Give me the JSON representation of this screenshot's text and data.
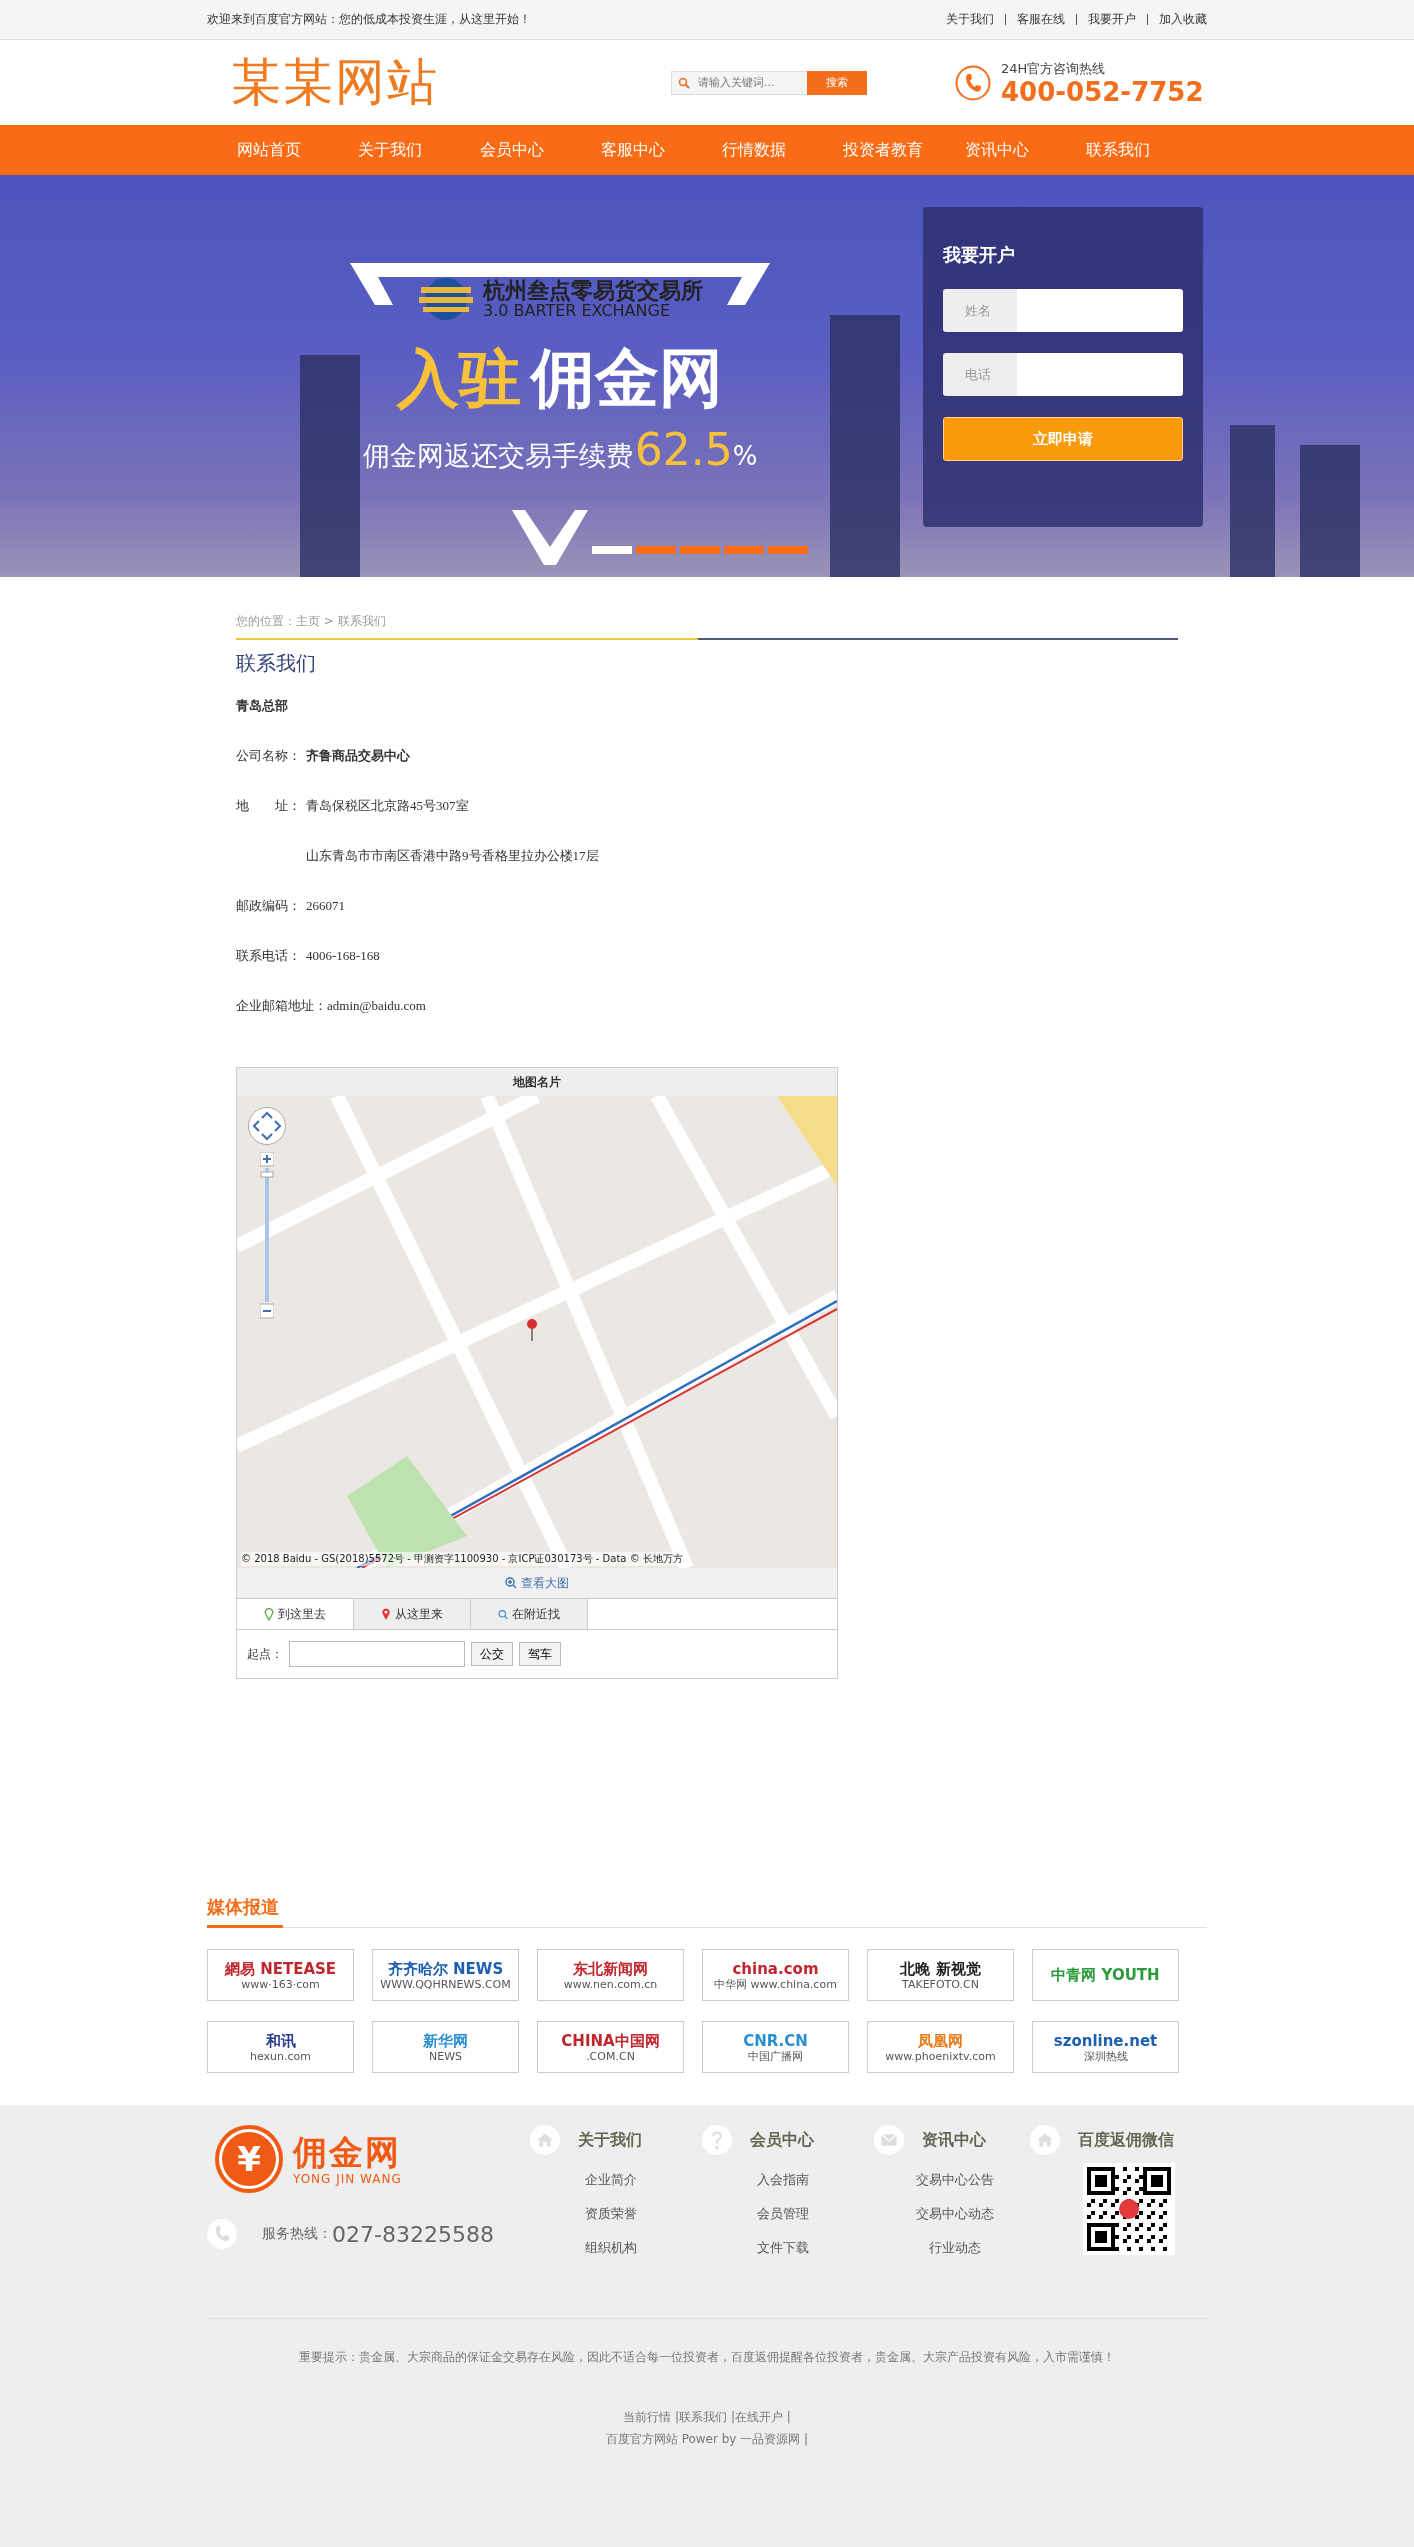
{
  "top_bar": {
    "welcome": "欢迎来到百度官方网站：您的低成本投资生涯，从这里开始！",
    "links": [
      "关于我们",
      "客服在线",
      "我要开户",
      "加入收藏"
    ]
  },
  "header": {
    "logo": "某某网站",
    "search": {
      "placeholder": "请输入关键词...",
      "button": "搜索"
    },
    "hotline": {
      "label": "24H官方咨询热线",
      "number": "400-052-7752"
    }
  },
  "nav": [
    "网站首页",
    "关于我们",
    "会员中心",
    "客服中心",
    "行情数据",
    "投资者教育",
    "资讯中心",
    "联系我们"
  ],
  "banner": {
    "exchange_name": "杭州叁点零易货交易所",
    "exchange_en": "3.0 BARTER EXCHANGE",
    "headline_script": "入驻",
    "headline": "佣金网",
    "tagline": "佣金网返还交易手续费",
    "rate": "62.5",
    "percent": "%",
    "slides": [
      {
        "selected": true
      },
      {
        "selected": false
      },
      {
        "selected": false
      },
      {
        "selected": false
      },
      {
        "selected": false
      }
    ],
    "signup": {
      "title": "我要开户",
      "fields": [
        {
          "placeholder": "姓名"
        },
        {
          "placeholder": "电话"
        }
      ],
      "button": "立即申请"
    }
  },
  "breadcrumb": "您的位置：主页 > 联系我们",
  "page_title": "联系我们",
  "contact": {
    "heading": "青岛总部",
    "rows": [
      {
        "kind": "bold",
        "label": "公司名称：",
        "value": "齐鲁商品交易中心"
      },
      {
        "kind": "plain",
        "label": "地　　址：",
        "value": "青岛保税区北京路45号307室"
      },
      {
        "kind": "continued",
        "value": "山东青岛市市南区香港中路9号香格里拉办公楼17层"
      },
      {
        "kind": "plain",
        "label": "邮政编码：",
        "value": "266071"
      },
      {
        "kind": "plain",
        "label": "联系电话：",
        "value": "4006-168-168"
      },
      {
        "kind": "plain",
        "label": "企业邮箱地址：",
        "value": "admin@baidu.com"
      }
    ]
  },
  "map_card": {
    "title": "地图名片",
    "copyright": "© 2018 Baidu - GS(2018)5572号 - 甲测资字1100930 - 京ICP证030173号 - Data © 长地万方",
    "view_large": "查看大图",
    "tabs": [
      {
        "label": "到这里去",
        "selected": true
      },
      {
        "label": "从这里来",
        "selected": false
      },
      {
        "label": "在附近找",
        "selected": false
      }
    ],
    "start_label": "起点：",
    "buttons": [
      "公交",
      "驾车"
    ]
  },
  "media": {
    "title": "媒体报道",
    "logos": [
      {
        "main": "網易 NETEASE",
        "sub": "www·163·com",
        "color": "#c0262d"
      },
      {
        "main": "齐齐哈尔 NEWS",
        "sub": "WWW.QQHRNEWS.COM",
        "color": "#1f5fb0"
      },
      {
        "main": "东北新闻网",
        "sub": "www.nen.com.cn",
        "color": "#c0262d"
      },
      {
        "main": "china.com",
        "sub": "中华网 www.china.com",
        "color": "#c0262d"
      },
      {
        "main": "北晚 新视觉",
        "sub": "TAKEFOTO.CN",
        "color": "#222222"
      },
      {
        "main": "中青网 YOUTH",
        "color": "#2a9a3a"
      },
      {
        "main": "和讯",
        "sub": "hexun.com",
        "color": "#2a3f8f"
      },
      {
        "main": "新华网",
        "sub": "NEWS",
        "color": "#2a8fd0"
      },
      {
        "main": "CHINA中国网",
        "sub": ".COM.CN",
        "color": "#c0262d"
      },
      {
        "main": "CNR.CN",
        "sub": "中国广播网",
        "color": "#2a8fd0"
      },
      {
        "main": "凤凰网",
        "sub": "www.phoenixtv.com",
        "color": "#e87a1a"
      },
      {
        "main": "szonline.net",
        "sub": "深圳热线",
        "color": "#1f5fb0"
      }
    ]
  },
  "footer": {
    "logo": {
      "symbol": "¥",
      "name": "佣金网",
      "pinyin": "YONG JIN WANG"
    },
    "hotline_label": "服务热线：",
    "hotline": "027-83225588",
    "columns": [
      {
        "title": "关于我们",
        "links": [
          "企业简介",
          "资质荣誉",
          "组织机构"
        ]
      },
      {
        "title": "会员中心",
        "links": [
          "入会指南",
          "会员管理",
          "文件下载"
        ]
      },
      {
        "title": "资讯中心",
        "links": [
          "交易中心公告",
          "交易中心动态",
          "行业动态"
        ]
      }
    ],
    "wechat": {
      "title": "百度返佣微信"
    },
    "notice": "重要提示：贵金属、大宗商品的保证金交易存在风险，因此不适合每一位投资者，百度返佣提醒各位投资者，贵金属、大宗产品投资有风险，入市需谨慎！",
    "links": "当前行情 |联系我们 |在线开户 |",
    "power": "百度官方网站 Power by 一品资源网 |"
  }
}
